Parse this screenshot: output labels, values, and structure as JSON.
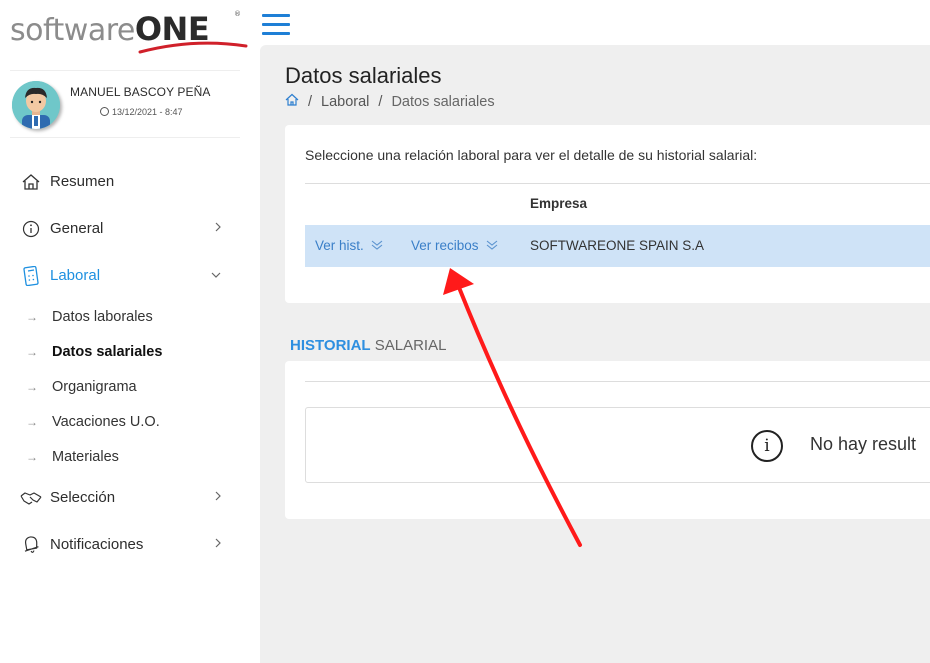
{
  "brand": {
    "logo_prefix": "software",
    "logo_suffix": "ONE",
    "logo_mark": "®"
  },
  "user": {
    "name": "MANUEL BASCOY PEÑA",
    "last_access": "13/12/2021 - 8:47"
  },
  "nav": {
    "items": [
      {
        "label": "Resumen",
        "icon": "house-icon"
      },
      {
        "label": "General",
        "icon": "info-icon"
      },
      {
        "label": "Laboral",
        "icon": "calculator-icon"
      }
    ],
    "laboral_sub": [
      {
        "label": "Datos laborales"
      },
      {
        "label": "Datos salariales"
      },
      {
        "label": "Organigrama"
      },
      {
        "label": "Vacaciones U.O."
      },
      {
        "label": "Materiales"
      }
    ],
    "bottom_items": [
      {
        "label": "Selección",
        "icon": "handshake-icon"
      },
      {
        "label": "Notificaciones",
        "icon": "bell-icon"
      }
    ]
  },
  "page": {
    "title": "Datos salariales",
    "breadcrumb": [
      "Laboral",
      "Datos salariales"
    ],
    "breadcrumb_sep": "/"
  },
  "relations": {
    "instruction": "Seleccione una relación laboral para ver el detalle de su historial salarial:",
    "column_empresa": "Empresa",
    "row": {
      "ver_hist": "Ver hist.",
      "ver_recibos": "Ver recibos",
      "empresa": "SOFTWAREONE SPAIN S.A"
    }
  },
  "history": {
    "title_highlight": "HISTORIAL",
    "title_rest": "SALARIAL",
    "empty_message": "No hay result"
  },
  "colors": {
    "accent": "#1e90e0",
    "row_highlight": "#cfe3f7",
    "annotation": "#ff1a1a",
    "main_bg": "#efefef"
  }
}
